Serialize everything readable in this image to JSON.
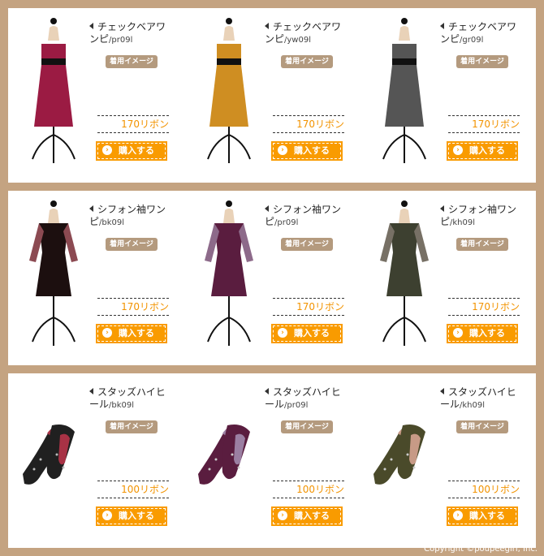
{
  "rows": [
    {
      "items": [
        {
          "title": "チェックベアワンピ",
          "code": "/pr09l",
          "image_label": "着用イメージ",
          "price": "170リボン",
          "buy_label": "購入する",
          "color": "#9b1b43"
        },
        {
          "title": "チェックベアワンピ",
          "code": "/yw09l",
          "image_label": "着用イメージ",
          "price": "170リボン",
          "buy_label": "購入する",
          "color": "#cf8e22"
        },
        {
          "title": "チェックベアワンピ",
          "code": "/gr09l",
          "image_label": "着用イメージ",
          "price": "170リボン",
          "buy_label": "購入する",
          "color": "#555555"
        }
      ]
    },
    {
      "items": [
        {
          "title": "シフォン袖ワンピ",
          "code": "/bk09l",
          "image_label": "着用イメージ",
          "price": "170リボン",
          "buy_label": "購入する",
          "color": "#1c0f0f"
        },
        {
          "title": "シフォン袖ワンピ",
          "code": "/pr09l",
          "image_label": "着用イメージ",
          "price": "170リボン",
          "buy_label": "購入する",
          "color": "#5a1d3f"
        },
        {
          "title": "シフォン袖ワンピ",
          "code": "/kh09l",
          "image_label": "着用イメージ",
          "price": "170リボン",
          "buy_label": "購入する",
          "color": "#3d4030"
        }
      ]
    },
    {
      "items": [
        {
          "title": "スタッズハイヒール",
          "code": "/bk09l",
          "image_label": "着用イメージ",
          "price": "100リボン",
          "buy_label": "購入する",
          "color": "#202020"
        },
        {
          "title": "スタッズハイヒール",
          "code": "/pr09l",
          "image_label": "着用イメージ",
          "price": "100リボン",
          "buy_label": "購入する",
          "color": "#5a1d3f"
        },
        {
          "title": "スタッズハイヒール",
          "code": "/kh09l",
          "image_label": "着用イメージ",
          "price": "100リボン",
          "buy_label": "購入する",
          "color": "#4a4a2a"
        }
      ]
    }
  ],
  "copyright": "Copyright ©poupeegirl, Inc."
}
